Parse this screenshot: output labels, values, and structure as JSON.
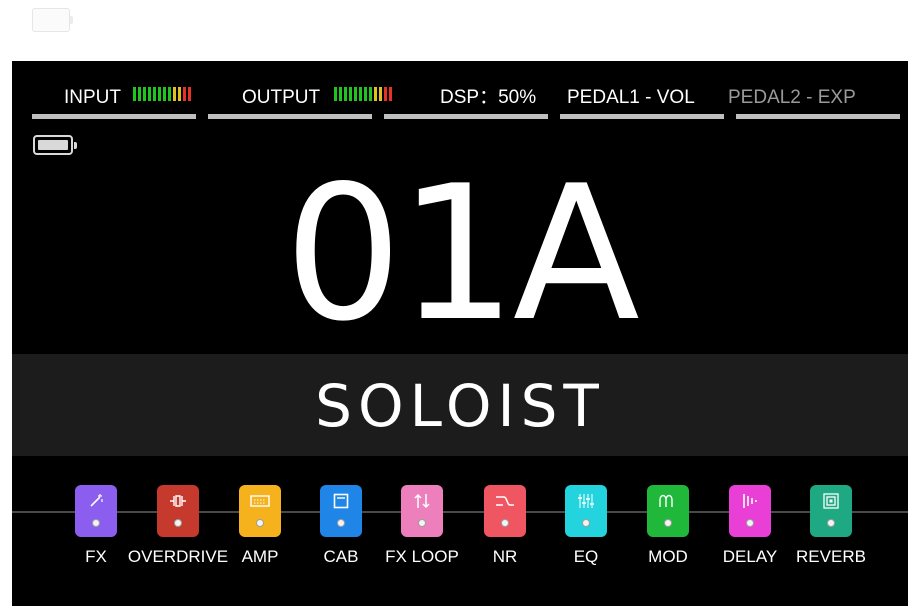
{
  "status_bar": {
    "input_label": "INPUT",
    "output_label": "OUTPUT",
    "dsp_label": "DSP：50%",
    "pedal1_label": "PEDAL1 - VOL",
    "pedal2_label": "PEDAL2 - EXP",
    "meter_colors": [
      "#1fc41f",
      "#1fc41f",
      "#1fc41f",
      "#1fc41f",
      "#1fc41f",
      "#1fc41f",
      "#1fc41f",
      "#1fc41f",
      "#e0c21a",
      "#e0c21a",
      "#e83228",
      "#e83228"
    ]
  },
  "preset": {
    "number": "01A",
    "name": "SOLOIST"
  },
  "chain": [
    {
      "label": "FX",
      "color": "#8b5ef0",
      "icon": "magic-wand-icon"
    },
    {
      "label": "OVERDRIVE",
      "color": "#c53a2c",
      "icon": "overdrive-icon"
    },
    {
      "label": "AMP",
      "color": "#f6b21c",
      "icon": "amp-icon"
    },
    {
      "label": "CAB",
      "color": "#1f86e8",
      "icon": "cabinet-icon"
    },
    {
      "label": "FX LOOP",
      "color": "#ee7fbd",
      "icon": "loop-arrows-icon"
    },
    {
      "label": "NR",
      "color": "#ef5661",
      "icon": "noise-reduction-icon"
    },
    {
      "label": "EQ",
      "color": "#23d4de",
      "icon": "equalizer-icon"
    },
    {
      "label": "MOD",
      "color": "#1fb83a",
      "icon": "modulation-icon"
    },
    {
      "label": "DELAY",
      "color": "#ea3fd6",
      "icon": "delay-icon"
    },
    {
      "label": "REVERB",
      "color": "#1fa982",
      "icon": "reverb-icon"
    }
  ]
}
